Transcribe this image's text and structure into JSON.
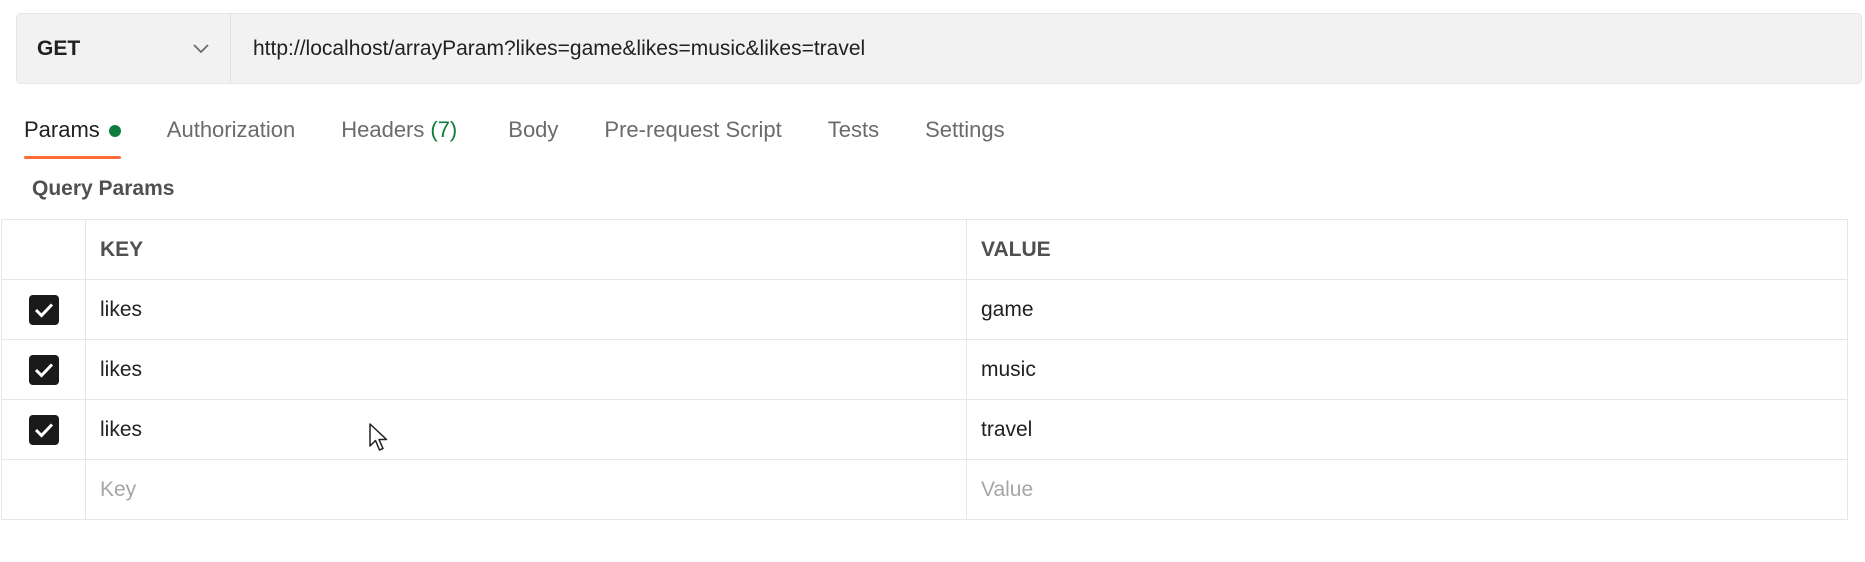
{
  "request": {
    "method": "GET",
    "url": "http://localhost/arrayParam?likes=game&likes=music&likes=travel"
  },
  "tabs": [
    {
      "label": "Params",
      "active": true,
      "indicator": "green-dot"
    },
    {
      "label": "Authorization"
    },
    {
      "label": "Headers",
      "count": "(7)"
    },
    {
      "label": "Body"
    },
    {
      "label": "Pre-request Script"
    },
    {
      "label": "Tests"
    },
    {
      "label": "Settings"
    }
  ],
  "query_params": {
    "title": "Query Params",
    "columns": {
      "key": "KEY",
      "value": "VALUE"
    },
    "rows": [
      {
        "checked": true,
        "key": "likes",
        "value": "game"
      },
      {
        "checked": true,
        "key": "likes",
        "value": "music"
      },
      {
        "checked": true,
        "key": "likes",
        "value": "travel"
      }
    ],
    "placeholders": {
      "key": "Key",
      "value": "Value"
    }
  },
  "colors": {
    "active_tab_underline": "#ff6c37",
    "indicator": "#0f7b3e",
    "checkbox": "#1a1a1a"
  }
}
